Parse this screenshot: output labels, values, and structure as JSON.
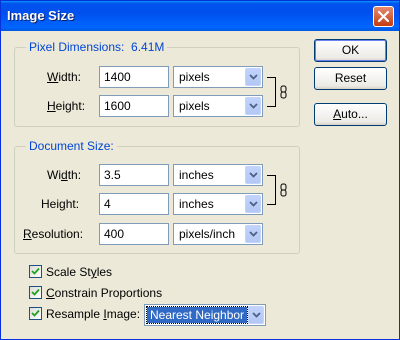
{
  "window": {
    "title": "Image Size"
  },
  "pixel_dimensions": {
    "legend": "Pixel Dimensions:  6.41M",
    "width": {
      "label_pre": "",
      "label_ul": "W",
      "label_post": "idth:",
      "value": "1400",
      "unit": "pixels"
    },
    "height": {
      "label_pre": "",
      "label_ul": "H",
      "label_post": "eight:",
      "value": "1600",
      "unit": "pixels"
    }
  },
  "document_size": {
    "legend": "Document Size:",
    "width": {
      "label_pre": "Wi",
      "label_ul": "d",
      "label_post": "th:",
      "value": "3.5",
      "unit": "inches"
    },
    "height": {
      "label_pre": "Hei",
      "label_ul": "g",
      "label_post": "ht:",
      "value": "4",
      "unit": "inches"
    },
    "resolution": {
      "label_pre": "",
      "label_ul": "R",
      "label_post": "esolution:",
      "value": "400",
      "unit": "pixels/inch"
    }
  },
  "buttons": {
    "ok": "OK",
    "reset": "Reset",
    "auto_ul": "A",
    "auto_post": "uto..."
  },
  "options": {
    "scale_styles": {
      "pre": "Scale St",
      "ul": "y",
      "post": "les",
      "checked": true
    },
    "constrain": {
      "pre": "",
      "ul": "C",
      "post": "onstrain Proportions",
      "checked": true
    },
    "resample": {
      "pre": "Resample ",
      "ul": "I",
      "post": "mage:",
      "checked": true,
      "method": "Nearest Neighbor"
    }
  },
  "icons": {
    "close": "close-icon",
    "link": "chain-link-icon",
    "dropdown": "chevron-down-icon",
    "check": "checkmark-icon"
  },
  "colors": {
    "title_bar": "#0053ee",
    "group_legend": "#0046d5",
    "close_button": "#c33d13",
    "selection": "#316ac5"
  }
}
